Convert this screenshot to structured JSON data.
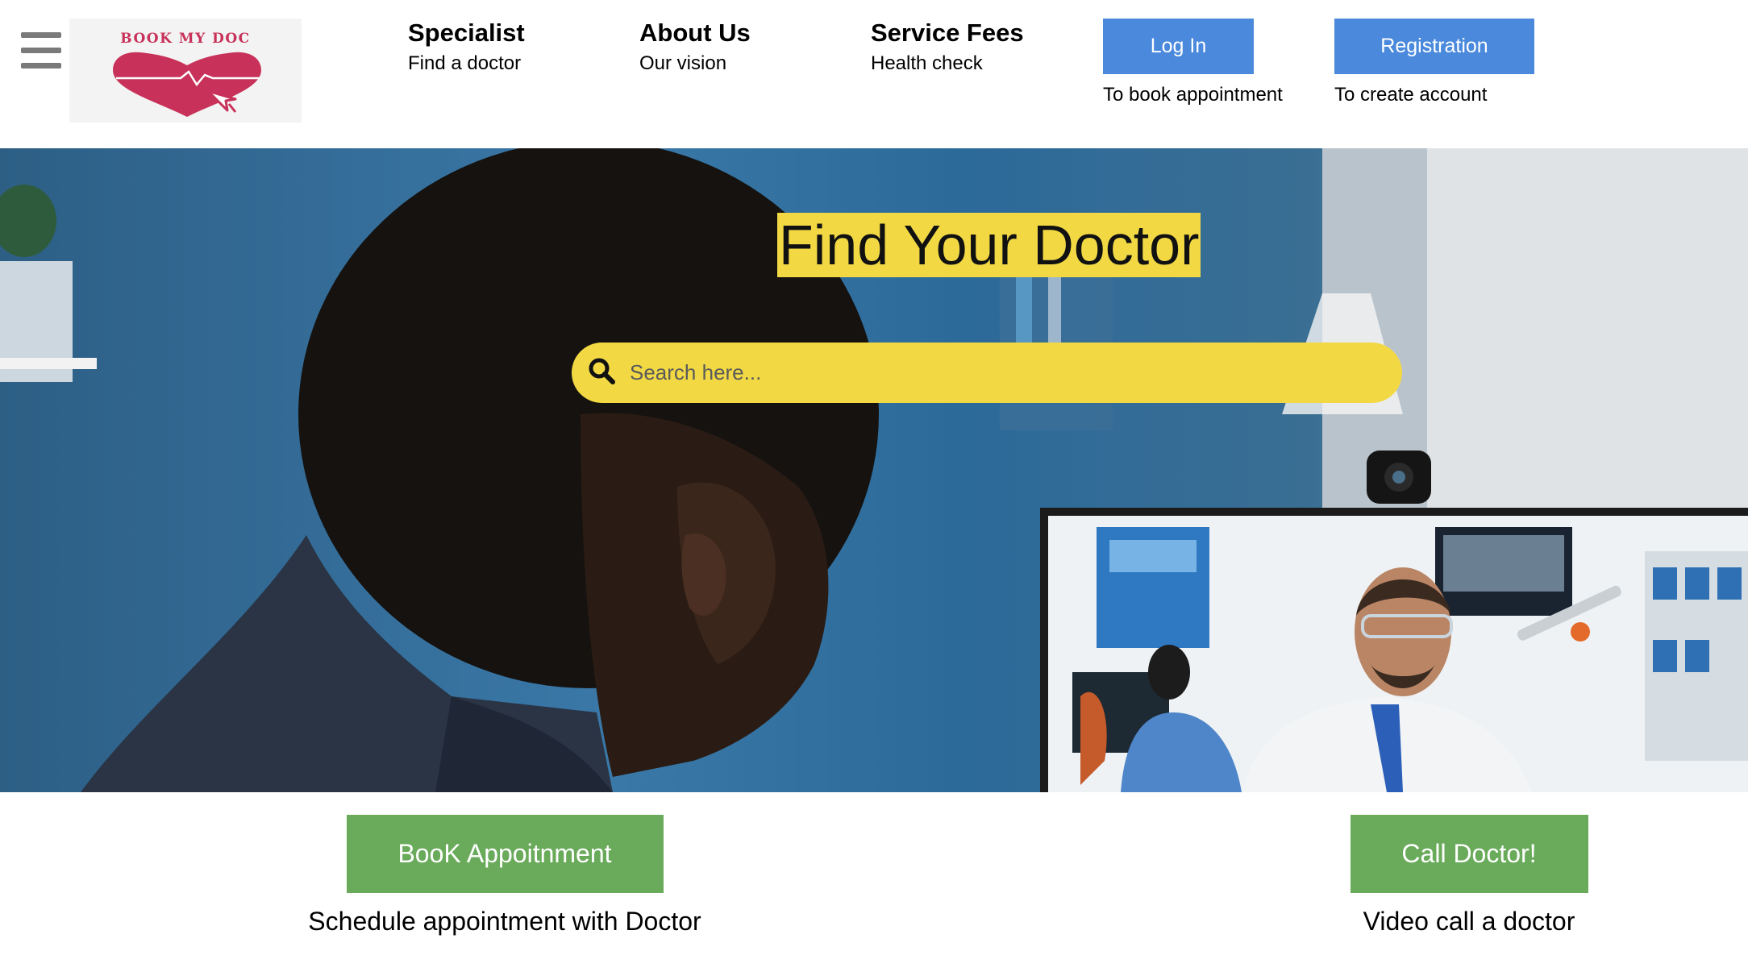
{
  "brand": {
    "logo_text": "BOOK MY DOC",
    "accent": "#c8325a"
  },
  "nav": [
    {
      "title": "Specialist",
      "subtitle": "Find a doctor"
    },
    {
      "title": "About Us",
      "subtitle": "Our vision"
    },
    {
      "title": "Service Fees",
      "subtitle": "Health check"
    }
  ],
  "auth": {
    "login": {
      "label": "Log In",
      "caption": "To book appointment"
    },
    "register": {
      "label": "Registration",
      "caption": "To create account"
    },
    "color": "#4a89dc"
  },
  "hero": {
    "title": "Find Your Doctor",
    "search_placeholder": "Search here...",
    "highlight_color": "#f2d944"
  },
  "actions": {
    "book": {
      "label": "BooK Appoitnment",
      "caption": "Schedule appointment with Doctor"
    },
    "call": {
      "label": "Call Doctor!",
      "caption": "Video call a doctor"
    },
    "color": "#6aab5b"
  },
  "icons": [
    "menu-icon",
    "heart-logo-icon",
    "search-icon"
  ]
}
